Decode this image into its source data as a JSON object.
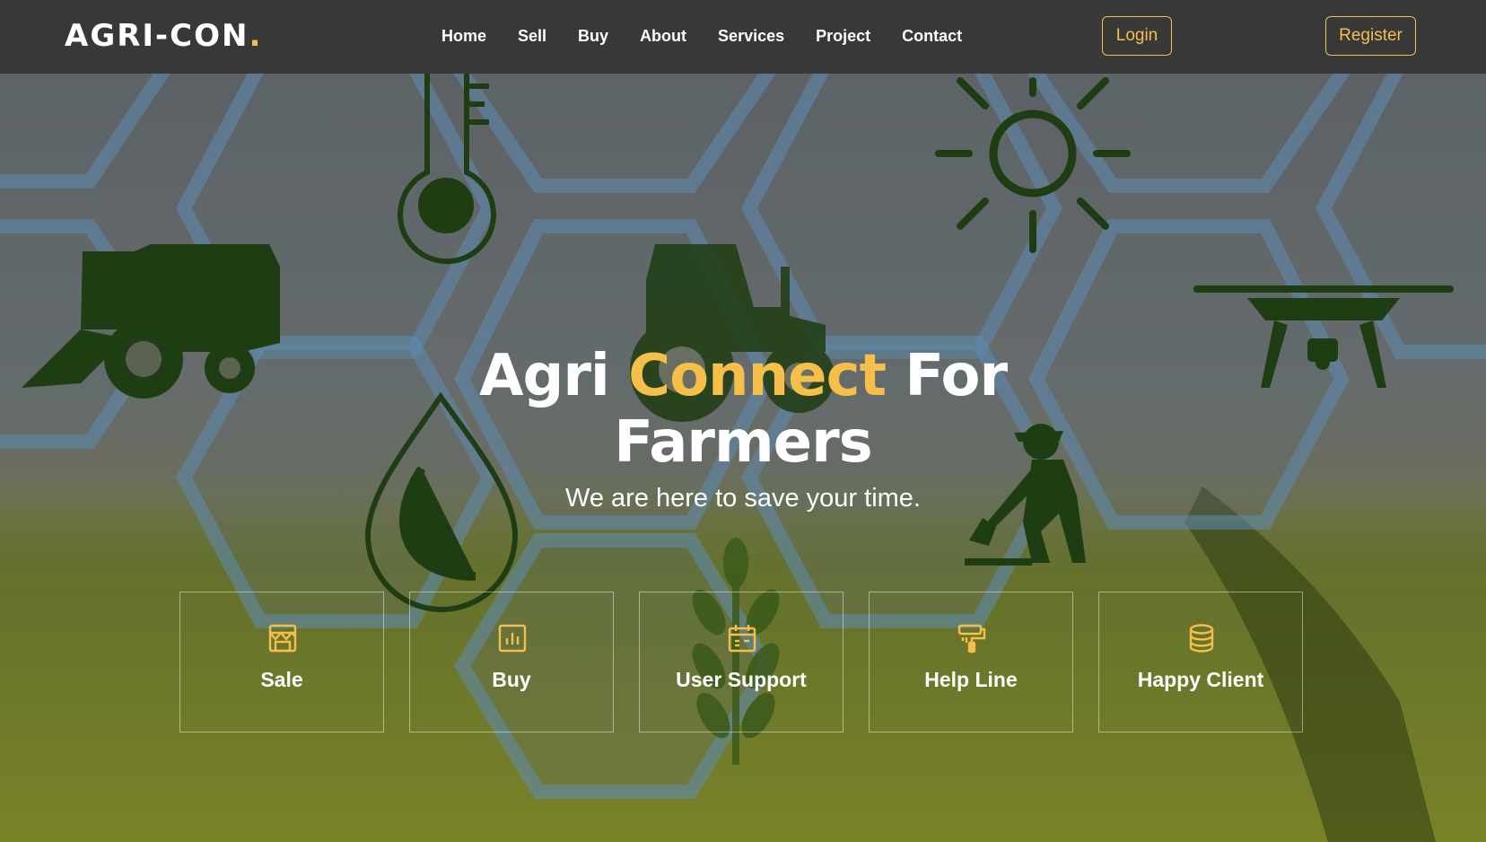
{
  "brand": {
    "name": "AGRI-CON",
    "dot": "."
  },
  "nav": {
    "links": [
      "Home",
      "Sell",
      "Buy",
      "About",
      "Services",
      "Project",
      "Contact"
    ],
    "login": "Login",
    "register": "Register"
  },
  "hero": {
    "title_part1": "Agri ",
    "title_accent": "Connect",
    "title_part2": " For Farmers",
    "subtitle": "We are here to save your time."
  },
  "features": [
    {
      "label": "Sale",
      "icon": "store-icon"
    },
    {
      "label": "Buy",
      "icon": "bar-chart-icon"
    },
    {
      "label": "User Support",
      "icon": "calendar-icon"
    },
    {
      "label": "Help Line",
      "icon": "paint-roller-icon"
    },
    {
      "label": "Happy Client",
      "icon": "database-icon"
    }
  ],
  "colors": {
    "accent": "#f5bf4a",
    "navbar": "#383838",
    "text": "#ffffff",
    "silhouette": "#1f3d12"
  }
}
